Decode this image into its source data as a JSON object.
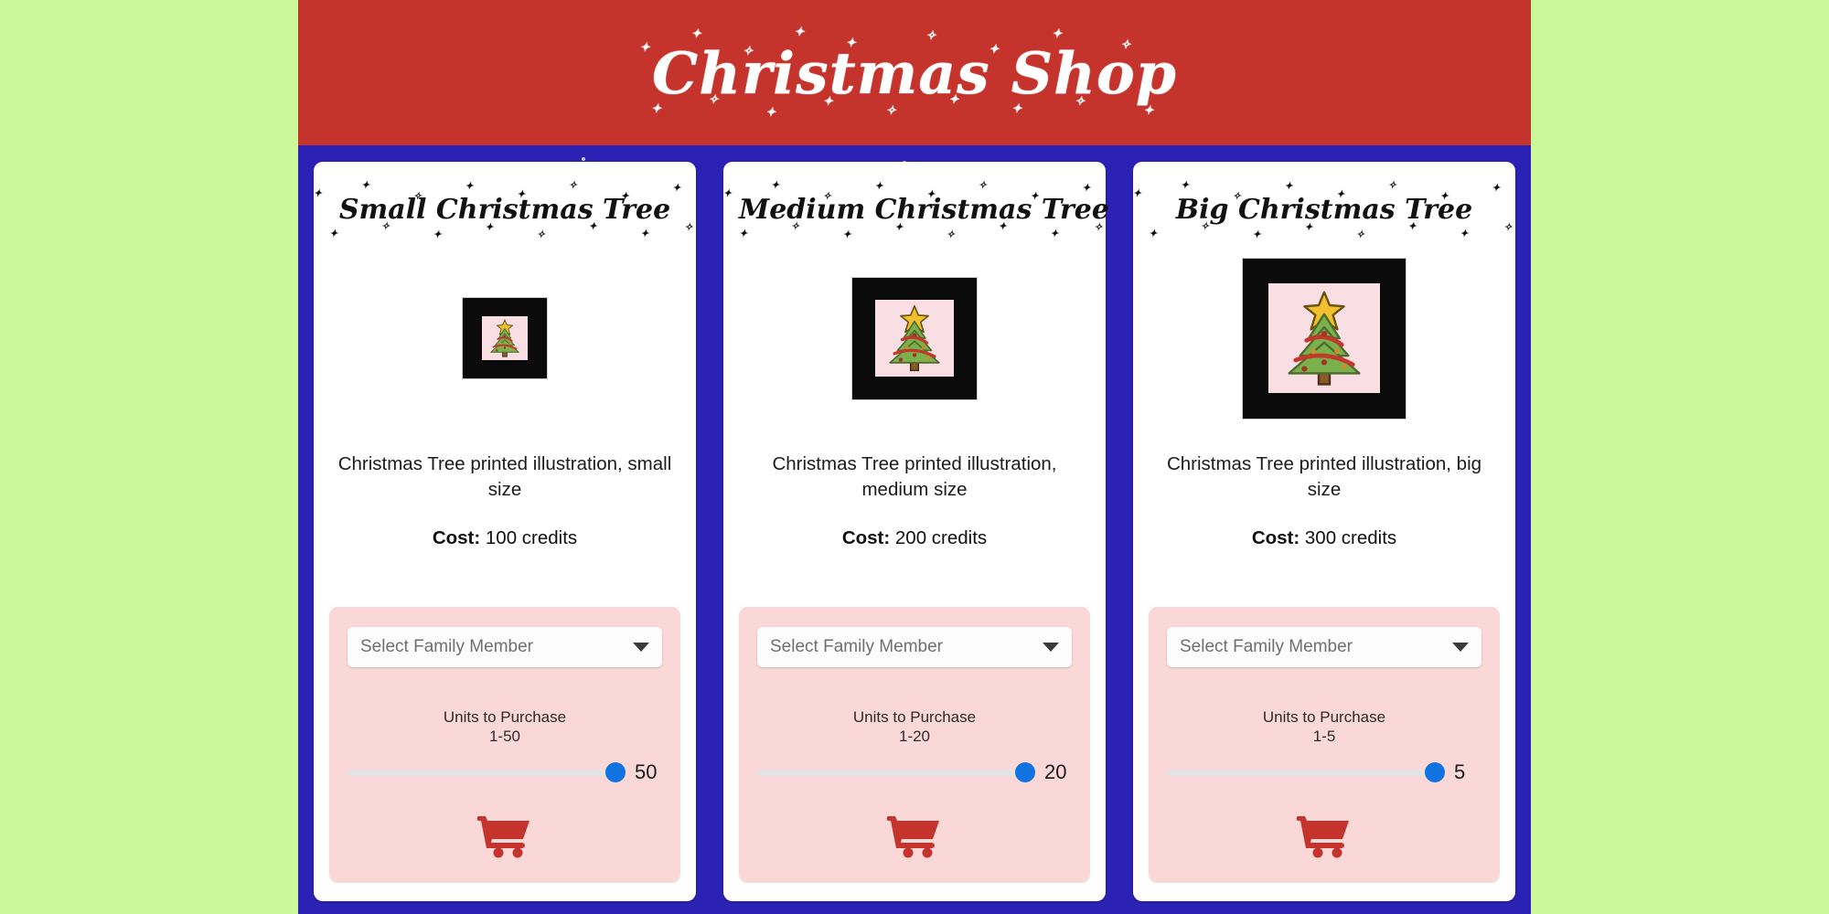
{
  "header": {
    "title": "Christmas Shop",
    "background_color": "#c5342c"
  },
  "theme": {
    "page_background": "#ccf79a",
    "board_background": "#2b22b5",
    "card_background": "#ffffff",
    "panel_background": "#fbd8d8",
    "slider_thumb_color": "#1273e0",
    "cart_icon_color": "#c5342c",
    "frame_color": "#0b0b0b",
    "mat_color": "#f9dfe4"
  },
  "products": [
    {
      "title": "Small Christmas Tree",
      "image_alt": "christmas-tree-framed-small",
      "size": "small",
      "description": "Christmas Tree printed illustration, small size",
      "cost_label": "Cost:",
      "cost_value": "100 credits",
      "select": {
        "placeholder": "Select Family Member",
        "value": "",
        "options": [
          "Select Family Member"
        ]
      },
      "slider": {
        "label": "Units to Purchase",
        "range_label": "1-50",
        "min": 1,
        "max": 50,
        "value": 50
      },
      "cart_button_label": "Add to cart"
    },
    {
      "title": "Medium Christmas Tree",
      "image_alt": "christmas-tree-framed-medium",
      "size": "medium",
      "description": "Christmas Tree printed illustration, medium size",
      "cost_label": "Cost:",
      "cost_value": "200 credits",
      "select": {
        "placeholder": "Select Family Member",
        "value": "",
        "options": [
          "Select Family Member"
        ]
      },
      "slider": {
        "label": "Units to Purchase",
        "range_label": "1-20",
        "min": 1,
        "max": 20,
        "value": 20
      },
      "cart_button_label": "Add to cart"
    },
    {
      "title": "Big Christmas Tree",
      "image_alt": "christmas-tree-framed-big",
      "size": "big",
      "description": "Christmas Tree printed illustration, big size",
      "cost_label": "Cost:",
      "cost_value": "300 credits",
      "select": {
        "placeholder": "Select Family Member",
        "value": "",
        "options": [
          "Select Family Member"
        ]
      },
      "slider": {
        "label": "Units to Purchase",
        "range_label": "1-5",
        "min": 1,
        "max": 5,
        "value": 5
      },
      "cart_button_label": "Add to cart"
    }
  ]
}
